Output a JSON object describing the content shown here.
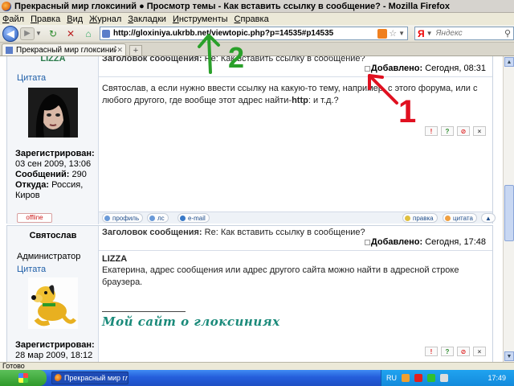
{
  "window": {
    "title": "Прекрасный мир глоксиний ● Просмотр темы - Как вставить ссылку в сообщение? - Mozilla Firefox"
  },
  "menu": [
    "Файл",
    "Правка",
    "Вид",
    "Журнал",
    "Закладки",
    "Инструменты",
    "Справка"
  ],
  "navbar": {
    "url": "http://gloxiniya.ukrbb.net/viewtopic.php?p=14535#p14535",
    "search_placeholder": "Яндекс",
    "search_engine_glyph": "Я"
  },
  "tab": {
    "label": "Прекрасный мир глоксиний ● ...",
    "new_tab_label": "+"
  },
  "posts": [
    {
      "author": "LIZZA",
      "author_color": "#2a7a4a",
      "quote_label": "Цитата",
      "subject_label": "Заголовок сообщения:",
      "subject": "Re: Как вставить ссылку в сообщение?",
      "posted_label": "Добавлено:",
      "posted_time": "Сегодня, 08:31",
      "body_part1": "Святослав, а если нужно ввести ссылку на какую-то тему, например, с этого форума, или с любого другого, где вообще этот адрес найти-",
      "body_bold": "http",
      "body_part2": ": и т.д.?",
      "profile": {
        "registered_label": "Зарегистрирован:",
        "registered_value": "03 сен 2009, 13:06",
        "posts_label": "Сообщений:",
        "posts_value": "290",
        "from_label": "Откуда:",
        "from_value": "Россия, Киров"
      },
      "status": "offline",
      "buttons": {
        "profile": "профиль",
        "pm": "лс",
        "email": "e-mail",
        "edit": "правка",
        "quote": "цитата"
      }
    },
    {
      "author": "Святослав",
      "author_color": "#d9541e",
      "role": "Администратор",
      "quote_label": "Цитата",
      "subject_label": "Заголовок сообщения:",
      "subject": "Re: Как вставить ссылку в сообщение?",
      "posted_label": "Добавлено:",
      "posted_time": "Сегодня, 17:48",
      "addressee": "LIZZA",
      "body": "Екатерина, адрес сообщения или адрес другого сайта можно найти в адресной строке браузера.",
      "signature": "Мой сайт о глоксиниях",
      "profile": {
        "registered_label": "Зарегистрирован:",
        "registered_value": "28 мар 2009, 18:12"
      }
    }
  ],
  "annotations": {
    "mark_1": "1",
    "mark_2": "2",
    "color": "#e01020",
    "color2": "#2aa02a"
  },
  "mini_action_glyphs": [
    "!",
    "?",
    "⊘",
    "×"
  ],
  "status_bar": "Готово",
  "taskbar": {
    "item": "Прекрасный мир гл...",
    "lang": "RU",
    "clock": "17:49"
  }
}
